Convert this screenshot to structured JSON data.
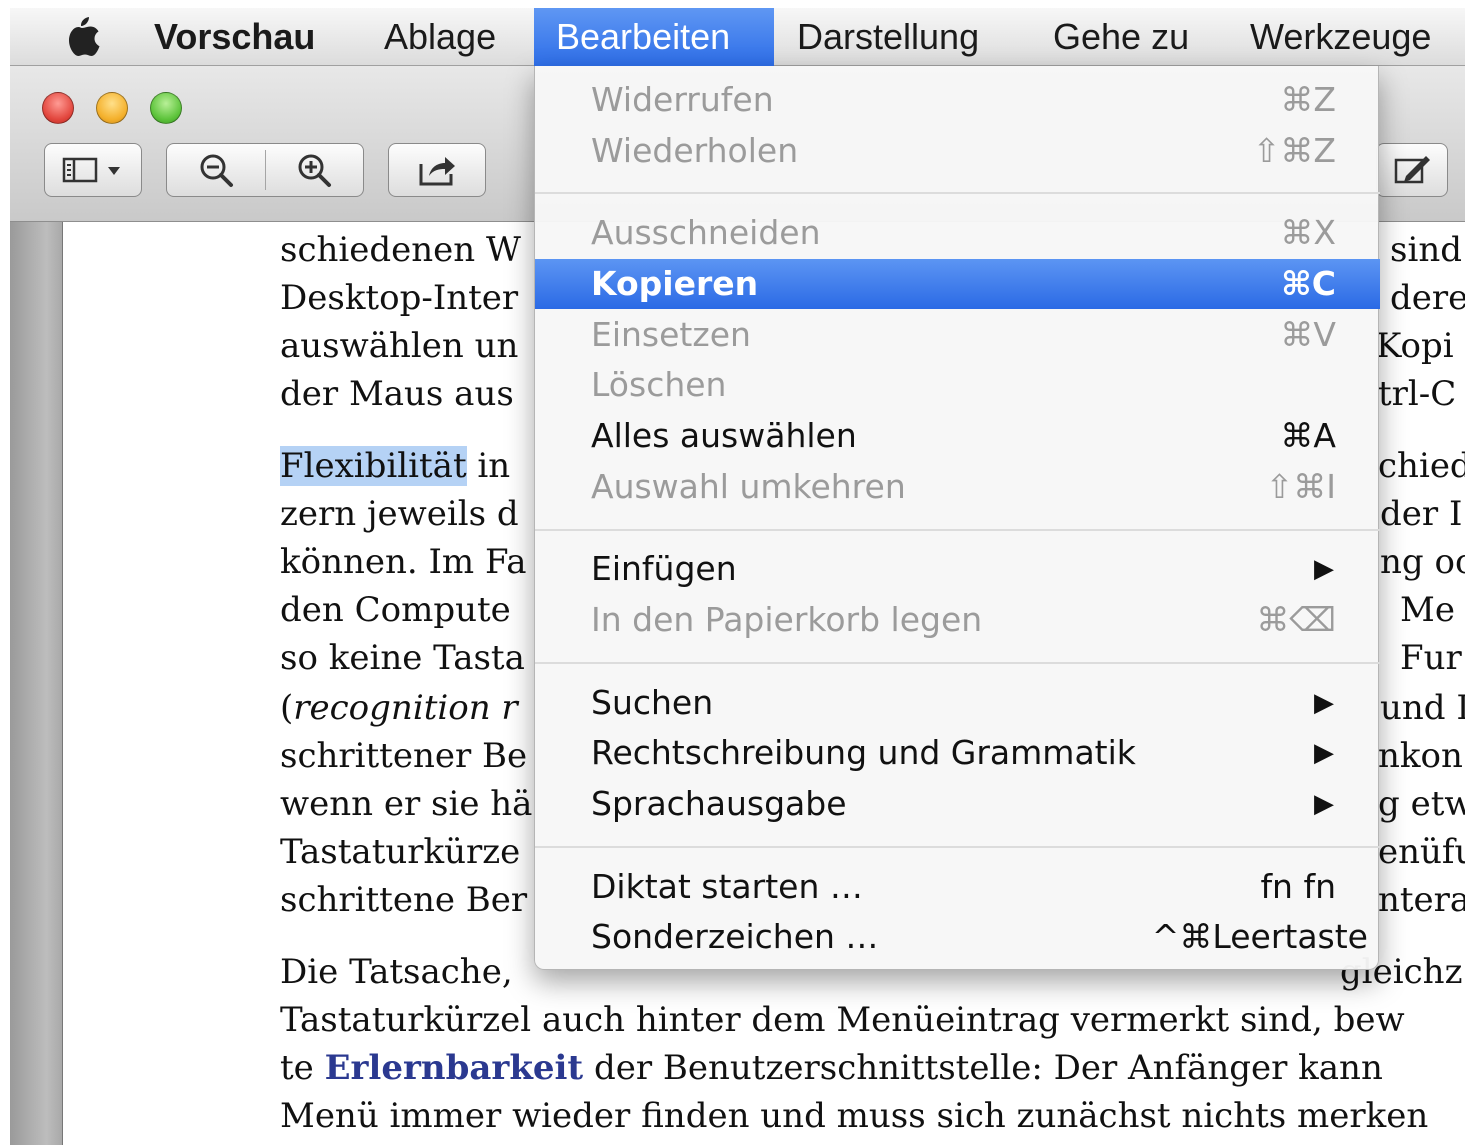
{
  "menubar": {
    "apple_icon": "apple-logo-icon",
    "app_name": "Vorschau",
    "items": [
      "Ablage",
      "Bearbeiten",
      "Darstellung",
      "Gehe zu",
      "Werkzeuge"
    ],
    "active_item": "Bearbeiten"
  },
  "toolbar": {
    "icons": [
      "sidebar-toggle-icon",
      "zoom-out-icon",
      "zoom-in-icon",
      "share-icon",
      "annotate-icon"
    ]
  },
  "edit_menu": {
    "items": [
      {
        "label": "Widerrufen",
        "shortcut": "⌘Z",
        "enabled": false
      },
      {
        "label": "Wiederholen",
        "shortcut": "⇧⌘Z",
        "enabled": false
      },
      {
        "label": "Ausschneiden",
        "shortcut": "⌘X",
        "enabled": false
      },
      {
        "label": "Kopieren",
        "shortcut": "⌘C",
        "enabled": true,
        "selected": true
      },
      {
        "label": "Einsetzen",
        "shortcut": "⌘V",
        "enabled": false
      },
      {
        "label": "Löschen",
        "shortcut": "",
        "enabled": false
      },
      {
        "label": "Alles auswählen",
        "shortcut": "⌘A",
        "enabled": true
      },
      {
        "label": "Auswahl umkehren",
        "shortcut": "⇧⌘I",
        "enabled": false
      },
      {
        "label": "Einfügen",
        "submenu": true,
        "enabled": true
      },
      {
        "label": "In den Papierkorb legen",
        "shortcut": "⌘⌫",
        "enabled": false
      },
      {
        "label": "Suchen",
        "submenu": true,
        "enabled": true
      },
      {
        "label": "Rechtschreibung und Grammatik",
        "submenu": true,
        "enabled": true
      },
      {
        "label": "Sprachausgabe",
        "submenu": true,
        "enabled": true
      },
      {
        "label": "Diktat starten …",
        "shortcut": "fn fn",
        "enabled": true
      },
      {
        "label": "Sonderzeichen …",
        "shortcut": "^⌘Leertaste",
        "enabled": true
      }
    ],
    "submenu_arrow": "▶"
  },
  "document": {
    "p1": [
      "schiedenen W",
      "Desktop-Inter",
      "auswählen un",
      "der Maus aus"
    ],
    "p1_right": [
      "sind",
      "dere",
      "Kopi",
      "trl-C"
    ],
    "p2_highlight": "Flexibilität",
    "p2_first_rest": " in",
    "p2": [
      "zern jeweils d",
      "können. Im Fa",
      "den Compute",
      "so keine Tasta",
      "(",
      "recognition r",
      "schrittener Be",
      "wenn er sie hä",
      "Tastaturkürze",
      "schrittene Ber"
    ],
    "p2_right": [
      "chied",
      "der I",
      "ng oc",
      "Me",
      "Fur",
      "und I",
      "nkon",
      "g etw",
      "enüfu",
      "ntera"
    ],
    "p3": [
      "Die Tatsache, ",
      "Tastaturkürzel auch hinter dem Menüeintrag vermerkt sind, bew",
      "te ",
      "Erlernbarkeit",
      " der Benutzerschnittstelle: Der Anfänger kann",
      "Menü immer wieder finden und muss sich zunächst nichts merken"
    ],
    "p3_first_right": "gleichz"
  },
  "colors": {
    "menu_highlight": "#2e6ee8",
    "text_highlight": "#b5d2f5",
    "link_blue": "#2b3990",
    "disabled_text": "#9b9b9b"
  }
}
